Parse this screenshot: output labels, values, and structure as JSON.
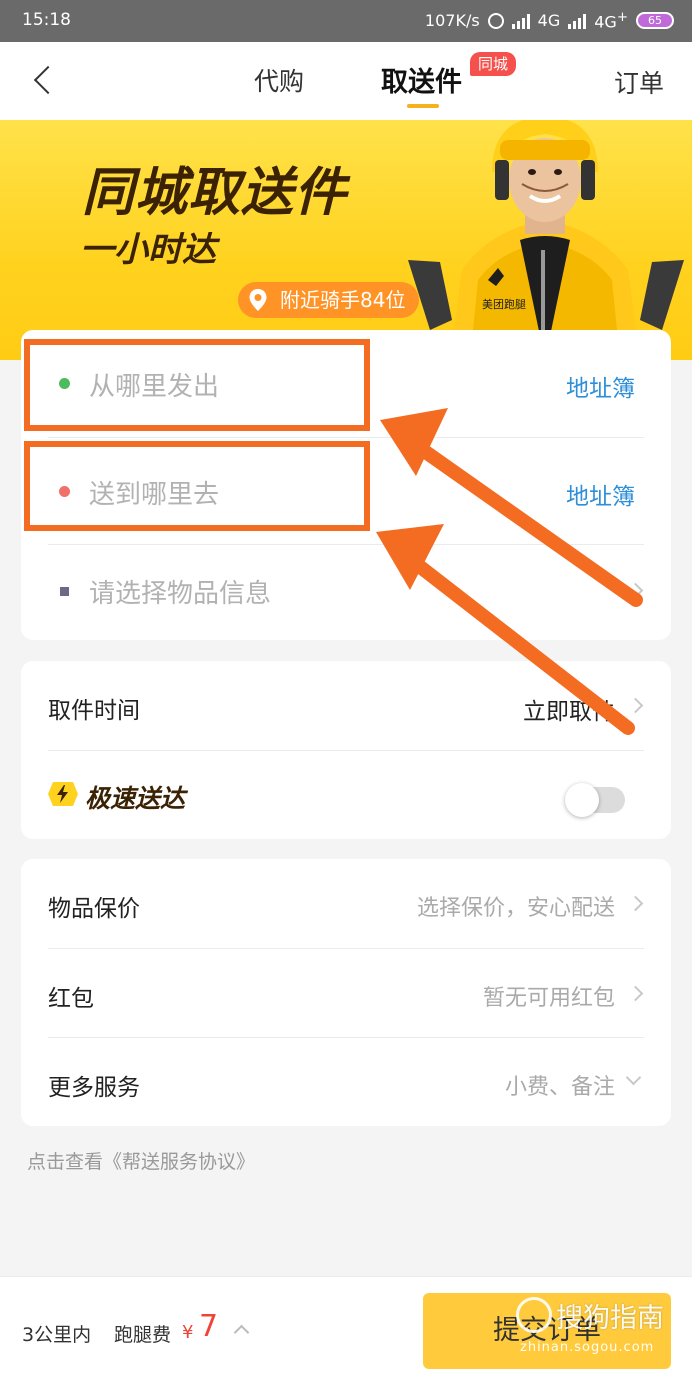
{
  "status_bar": {
    "time": "15:18",
    "speed": "107K/s",
    "network_1": "4G",
    "network_2": "4G",
    "network_2_plus": "+",
    "hd": "HD",
    "battery": "65"
  },
  "nav": {
    "tabs": [
      {
        "label": "代购"
      },
      {
        "label": "取送件",
        "badge": "同城",
        "active": true
      }
    ],
    "orders_label": "订单"
  },
  "banner": {
    "title": "同城取送件",
    "subtitle": "一小时达",
    "riders_nearby": "附近骑手84位",
    "rider_brand": "美团跑腿",
    "colors": {
      "bg": "#ffd21f",
      "tag": "#ff9325"
    }
  },
  "address_card": {
    "from_placeholder": "从哪里发出",
    "to_placeholder": "送到哪里去",
    "address_book": "地址簿",
    "item_placeholder": "请选择物品信息"
  },
  "time_card": {
    "pickup_label": "取件时间",
    "pickup_value": "立即取件",
    "express_label": "极速送达",
    "express_enabled": false
  },
  "options_card": {
    "rows": [
      {
        "label": "物品保价",
        "value": "选择保价，安心配送"
      },
      {
        "label": "红包",
        "value": "暂无可用红包"
      },
      {
        "label": "更多服务",
        "value": "小费、备注"
      }
    ]
  },
  "agreement": "点击查看《帮送服务协议》",
  "bottom_bar": {
    "distance": "3公里内",
    "fee_label": "跑腿费",
    "currency": "¥",
    "fee": "7",
    "submit": "提交订单"
  },
  "watermark": {
    "text": "搜狗指南",
    "url": "zhinan.sogou.com"
  },
  "annotation_color": "#f36c21"
}
